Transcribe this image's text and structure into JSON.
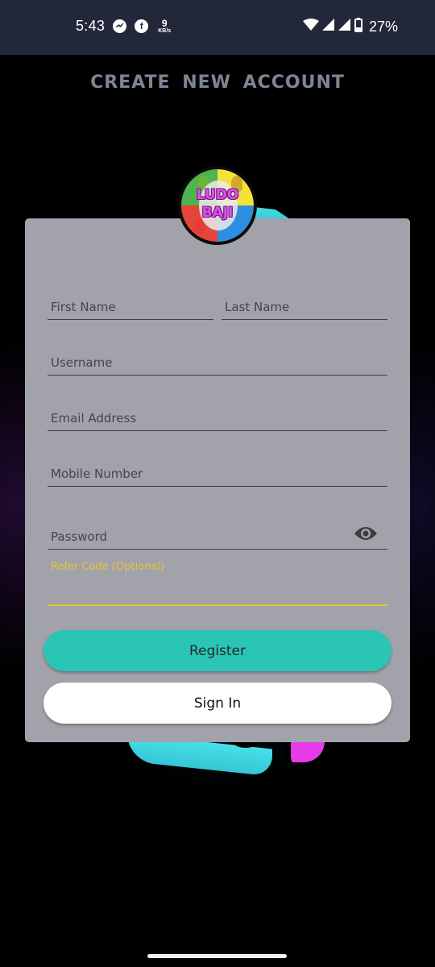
{
  "status_bar": {
    "time": "5:43",
    "notification_icons": [
      "messenger-icon",
      "facebook-icon"
    ],
    "net_speed_value": "9",
    "net_speed_unit": "KB/s",
    "battery_percent": "27%",
    "system_icons": [
      "wifi-icon",
      "signal-icon",
      "signal-icon",
      "battery-icon"
    ]
  },
  "page": {
    "title": "CREATE NEW ACCOUNT",
    "logo": {
      "line1": "LUDO",
      "line2": "BAJI"
    }
  },
  "form": {
    "first_name": {
      "placeholder": "First Name",
      "value": ""
    },
    "last_name": {
      "placeholder": "Last Name",
      "value": ""
    },
    "username": {
      "placeholder": "Username",
      "value": ""
    },
    "email": {
      "placeholder": "Email Address",
      "value": ""
    },
    "mobile": {
      "placeholder": "Mobile Number",
      "value": ""
    },
    "password": {
      "placeholder": "Password",
      "value": "",
      "toggle_icon": "eye-icon"
    },
    "refer_code": {
      "label": "Refer Code (Optional)",
      "value": ""
    }
  },
  "buttons": {
    "register": "Register",
    "sign_in": "Sign In"
  },
  "colors": {
    "accent_register": "#2ac5b4",
    "focus_yellow": "#e8c43a",
    "card_bg": "#a2a2aa",
    "status_bar_bg": "#222839",
    "title_color": "#7d8594"
  }
}
